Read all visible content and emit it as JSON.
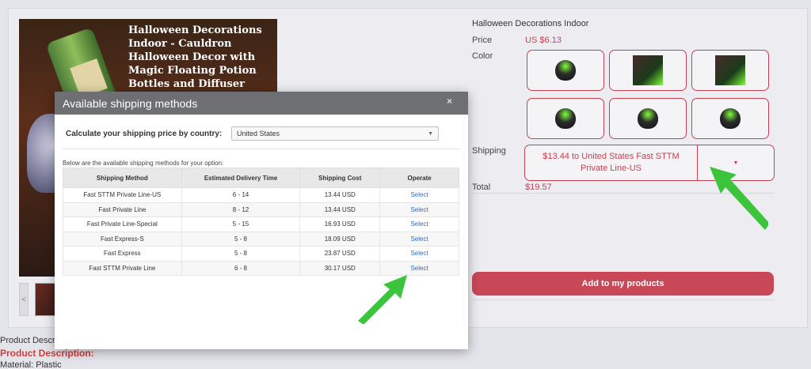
{
  "product": {
    "image_title": "Halloween Decorations Indoor - Cauldron Halloween Decor with Magic Floating Potion Bottles and Diffuser",
    "title": "Halloween Decorations Indoor",
    "price_label": "Price",
    "price_value": "US $6.13",
    "color_label": "Color",
    "shipping_label": "Shipping",
    "shipping_value": "$13.44 to United States Fast STTM Private Line-US",
    "total_label": "Total",
    "total_value": "$19.57",
    "add_button": "Add to my products",
    "thumb_prev": "<"
  },
  "description": {
    "line1": "Product Descri",
    "heading": "Product Description:",
    "line3": "Material: Plastic"
  },
  "modal": {
    "title": "Available shipping methods",
    "close": "×",
    "calc_label": "Calculate your shipping price by country:",
    "country": "United States",
    "intro": "Below are the available shipping methods for your option:",
    "columns": [
      "Shipping Method",
      "Estimated Delivery Time",
      "Shipping Cost",
      "Operate"
    ],
    "rows": [
      {
        "method": "Fast STTM Private Line-US",
        "time": "6 - 14",
        "cost": "13.44 USD",
        "op": "Select"
      },
      {
        "method": "Fast Private Line",
        "time": "8 - 12",
        "cost": "13.44 USD",
        "op": "Select"
      },
      {
        "method": "Fast Private Line-Special",
        "time": "5 - 15",
        "cost": "16.93 USD",
        "op": "Select"
      },
      {
        "method": "Fast Express-S",
        "time": "5 - 8",
        "cost": "18.09 USD",
        "op": "Select"
      },
      {
        "method": "Fast Express",
        "time": "5 - 8",
        "cost": "23.87 USD",
        "op": "Select"
      },
      {
        "method": "Fast STTM Private Line",
        "time": "6 - 8",
        "cost": "30.17 USD",
        "op": "Select"
      }
    ]
  },
  "colors": {
    "accent": "#c84050",
    "button": "#c84858",
    "link": "#2a6bbf",
    "arrow": "#3cc43c",
    "modal_header": "#6e6f73"
  }
}
